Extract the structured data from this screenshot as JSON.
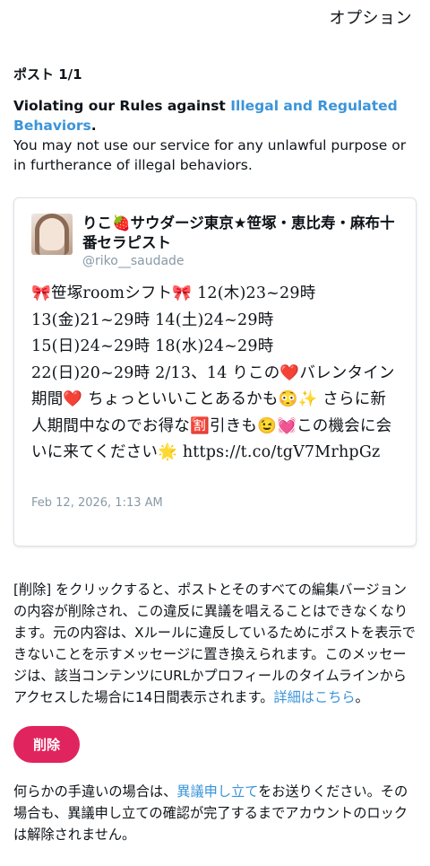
{
  "header": {
    "options_label": "オプション"
  },
  "post_count": "ポスト 1/1",
  "violation": {
    "headline_prefix": "Violating our Rules against ",
    "headline_link": "Illegal and Regulated Behaviors",
    "headline_suffix": ".",
    "description": "You may not use our service for any unlawful purpose or in furtherance of illegal behaviors."
  },
  "tweet": {
    "display_name": "りこ🍓サウダージ東京★笹塚・恵比寿・麻布十番セラピスト",
    "handle": "@riko__saudade",
    "text": "🎀笹塚roomシフト🎀 12(木)23~29時\n13(金)21~29時 14(土)24~29時\n15(日)24~29時 18(水)24~29時\n22(日)20~29時 2/13、14 りこの❤️バレンタイン期間❤️ ちょっといいことあるかも😳✨ さらに新人期間中なのでお得な🈹引きも😉💓この機会に会いに来てください🌟 https://t.co/tgV7MrhpGz",
    "timestamp": "Feb 12, 2026, 1:13 AM"
  },
  "notice": {
    "text": "[削除] をクリックすると、ポストとそのすべての編集バージョンの内容が削除され、この違反に異議を唱えることはできなくなります。元の内容は、Xルールに違反しているためにポストを表示できないことを示すメッセージに置き換えられます。このメッセージは、該当コンテンツにURLかプロフィールのタイムラインからアクセスした場合に14日間表示されます。",
    "link": "詳細はこちら",
    "suffix": "。"
  },
  "delete_button": {
    "label": "削除",
    "color": "#e0245e"
  },
  "appeal": {
    "prefix": "何らかの手違いの場合は、",
    "link": "異議申し立て",
    "suffix": "をお送りください。その場合も、異議申し立ての確認が完了するまでアカウントのロックは解除されません。"
  },
  "colors": {
    "link": "#3b94d9",
    "muted": "#8899a6",
    "text": "#0f1419"
  }
}
